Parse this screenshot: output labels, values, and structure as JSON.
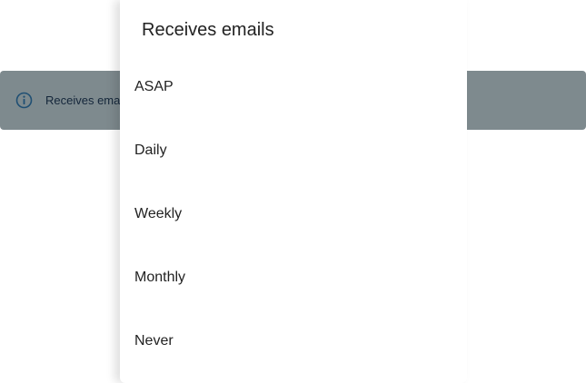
{
  "banner": {
    "icon": "info-icon",
    "text": "Receives ema",
    "background": "#7e8a8e",
    "icon_color": "#1f4f73"
  },
  "dropdown": {
    "title": "Receives emails",
    "options": [
      {
        "label": "ASAP"
      },
      {
        "label": "Daily"
      },
      {
        "label": "Weekly"
      },
      {
        "label": "Monthly"
      },
      {
        "label": "Never"
      }
    ]
  }
}
